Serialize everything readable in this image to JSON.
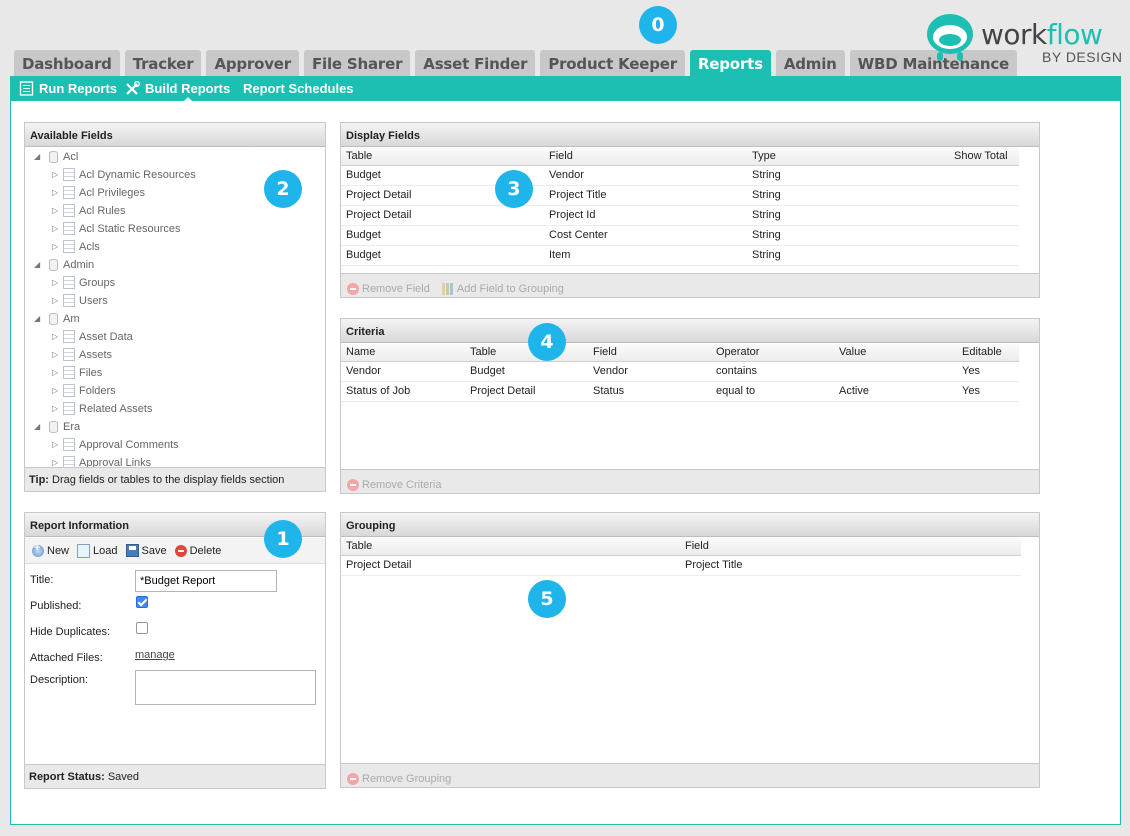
{
  "nav": {
    "tabs": [
      {
        "label": "Dashboard"
      },
      {
        "label": "Tracker"
      },
      {
        "label": "Approver"
      },
      {
        "label": "File Sharer"
      },
      {
        "label": "Asset Finder"
      },
      {
        "label": "Product Keeper"
      },
      {
        "label": "Reports"
      },
      {
        "label": "Admin"
      },
      {
        "label": "WBD Maintenance"
      }
    ],
    "active_tab": "Reports",
    "accent_color": "#1dbfb3"
  },
  "logo": {
    "text_a": "work",
    "text_b": "flow",
    "subtitle": "BY DESIGN"
  },
  "callouts": {
    "c0": "0",
    "c1": "1",
    "c2": "2",
    "c3": "3",
    "c4": "4",
    "c5": "5"
  },
  "subnav": {
    "run_reports": "Run Reports",
    "build_reports": "Build Reports",
    "report_schedules": "Report Schedules"
  },
  "available_fields": {
    "title": "Available Fields",
    "tip_bold": "Tip:",
    "tip_text": " Drag fields or tables to the display fields section",
    "tree": [
      {
        "label": "Acl",
        "level": 0
      },
      {
        "label": "Acl Dynamic Resources",
        "level": 1
      },
      {
        "label": "Acl Privileges",
        "level": 1
      },
      {
        "label": "Acl Rules",
        "level": 1
      },
      {
        "label": "Acl Static Resources",
        "level": 1
      },
      {
        "label": "Acls",
        "level": 1
      },
      {
        "label": "Admin",
        "level": 0
      },
      {
        "label": "Groups",
        "level": 1
      },
      {
        "label": "Users",
        "level": 1
      },
      {
        "label": "Am",
        "level": 0
      },
      {
        "label": "Asset Data",
        "level": 1
      },
      {
        "label": "Assets",
        "level": 1
      },
      {
        "label": "Files",
        "level": 1
      },
      {
        "label": "Folders",
        "level": 1
      },
      {
        "label": "Related Assets",
        "level": 1
      },
      {
        "label": "Era",
        "level": 0
      },
      {
        "label": "Approval Comments",
        "level": 1
      },
      {
        "label": "Approval Links",
        "level": 1
      }
    ]
  },
  "display_fields": {
    "title": "Display Fields",
    "columns": [
      "Table",
      "Field",
      "Type",
      "Show Total"
    ],
    "rows": [
      [
        "Budget",
        "Vendor",
        "String",
        ""
      ],
      [
        "Project Detail",
        "Project Title",
        "String",
        ""
      ],
      [
        "Project Detail",
        "Project Id",
        "String",
        ""
      ],
      [
        "Budget",
        "Cost Center",
        "String",
        ""
      ],
      [
        "Budget",
        "Item",
        "String",
        ""
      ]
    ],
    "remove_label": "Remove Field",
    "add_grouping_label": "Add Field to Grouping"
  },
  "criteria": {
    "title": "Criteria",
    "columns": [
      "Name",
      "Table",
      "Field",
      "Operator",
      "Value",
      "Editable"
    ],
    "rows": [
      [
        "Vendor",
        "Budget",
        "Vendor",
        "contains",
        "",
        "Yes"
      ],
      [
        "Status of Job",
        "Project Detail",
        "Status",
        "equal to",
        "Active",
        "Yes"
      ]
    ],
    "remove_label": "Remove Criteria"
  },
  "grouping": {
    "title": "Grouping",
    "columns": [
      "Table",
      "Field"
    ],
    "rows": [
      [
        "Project Detail",
        "Project Title"
      ]
    ],
    "remove_label": "Remove Grouping"
  },
  "report_info": {
    "title": "Report Information",
    "toolbar": {
      "new": "New",
      "load": "Load",
      "save": "Save",
      "delete": "Delete"
    },
    "title_label": "Title:",
    "title_value": "*Budget Report",
    "published_label": "Published:",
    "published": true,
    "hide_dup_label": "Hide Duplicates:",
    "hide_duplicates": false,
    "attached_label": "Attached Files:",
    "attached_link": "manage",
    "description_label": "Description:",
    "description_value": "",
    "status_label": "Report Status:",
    "status_value": " Saved"
  }
}
